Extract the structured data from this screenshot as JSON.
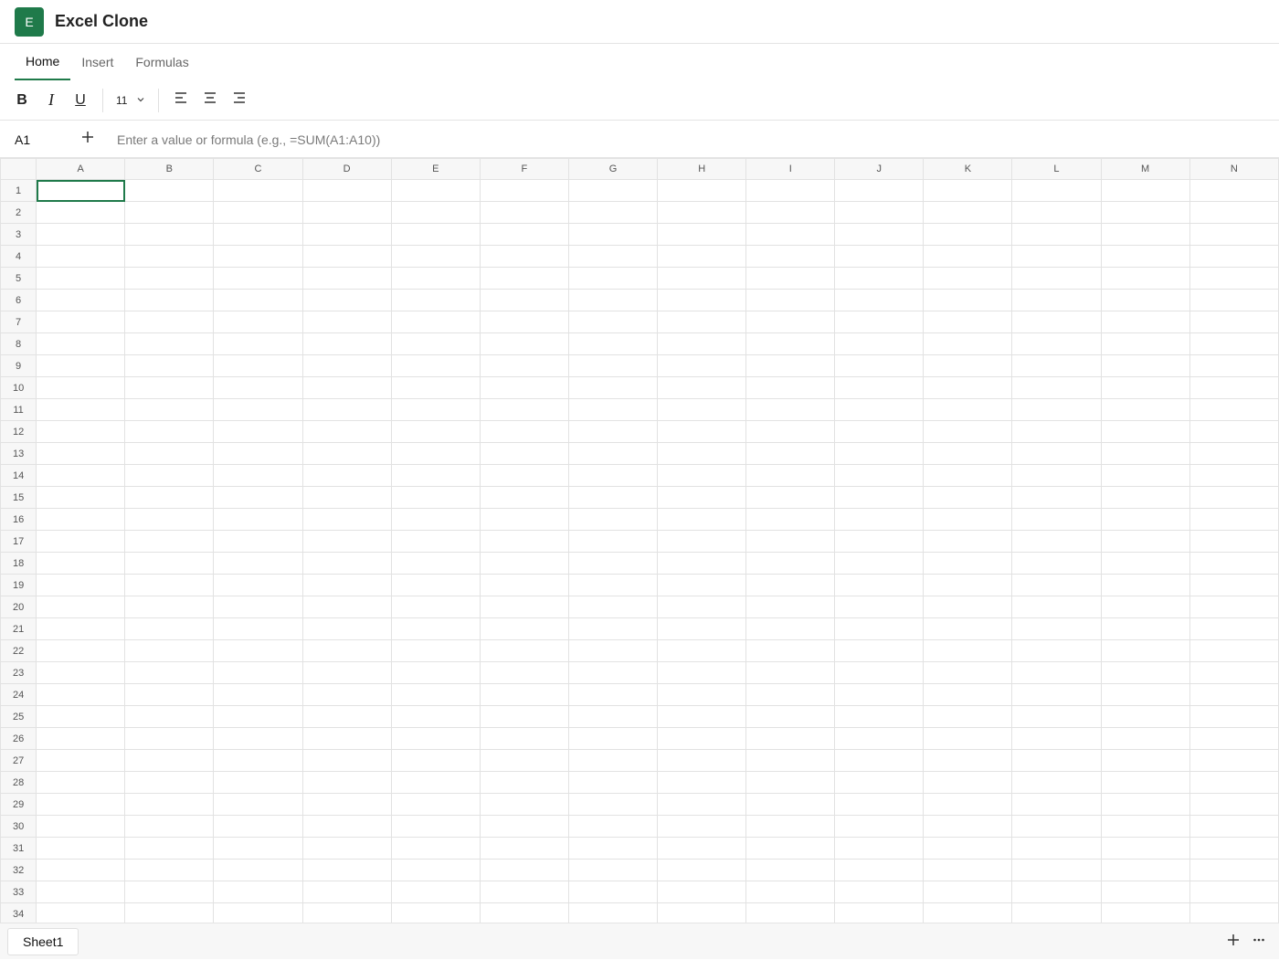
{
  "app": {
    "logo_letter": "E",
    "title": "Excel Clone",
    "accent": "#1f7a4a"
  },
  "tabs": [
    {
      "label": "Home",
      "active": true
    },
    {
      "label": "Insert",
      "active": false
    },
    {
      "label": "Formulas",
      "active": false
    }
  ],
  "toolbar": {
    "bold_label": "B",
    "italic_label": "I",
    "underline_label": "U",
    "font_size": "11",
    "icons": [
      "align-left-icon",
      "align-center-icon",
      "align-right-icon"
    ]
  },
  "formula_bar": {
    "cell_ref": "A1",
    "placeholder": "Enter a value or formula (e.g., =SUM(A1:A10))",
    "value": ""
  },
  "grid": {
    "columns": [
      "A",
      "B",
      "C",
      "D",
      "E",
      "F",
      "G",
      "H",
      "I",
      "J",
      "K",
      "L",
      "M",
      "N"
    ],
    "rows": [
      "1",
      "2",
      "3",
      "4",
      "5",
      "6",
      "7",
      "8",
      "9",
      "10",
      "11",
      "12",
      "13",
      "14",
      "15",
      "16",
      "17",
      "18",
      "19",
      "20",
      "21",
      "22",
      "23",
      "24",
      "25",
      "26",
      "27",
      "28",
      "29",
      "30",
      "31",
      "32",
      "33",
      "34"
    ],
    "selected_cell": "A1"
  },
  "sheets": [
    {
      "label": "Sheet1",
      "active": true
    }
  ]
}
